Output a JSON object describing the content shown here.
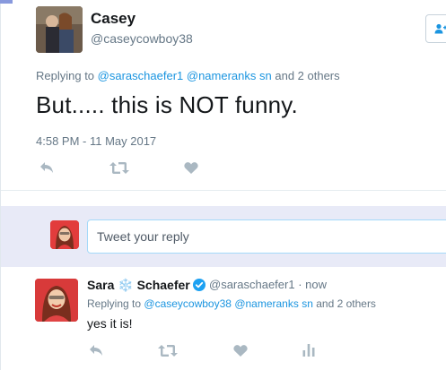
{
  "main_tweet": {
    "display_name": "Casey",
    "handle": "@caseycowboy38",
    "replying_prefix": "Replying to",
    "mention_1": "@saraschaefer1",
    "mention_2": "@nameranks sn",
    "others": "and 2 others",
    "text": "But..... this is NOT funny.",
    "timestamp": "4:58 PM - 11 May 2017"
  },
  "reply_box": {
    "placeholder": "Tweet your reply"
  },
  "reply_tweet": {
    "display_name_first": "Sara",
    "snowflake": "❄️",
    "display_name_last": "Schaefer",
    "handle": "@saraschaefer1",
    "separator": "·",
    "time": "now",
    "replying_prefix": "Replying to",
    "mention_1": "@caseycowboy38",
    "mention_2": "@nameranks sn",
    "others": "and 2 others",
    "text": "yes it is!"
  },
  "icons": {
    "reply": "reply-icon",
    "retweet": "retweet-icon",
    "like": "heart-icon",
    "analytics": "analytics-icon",
    "follow": "follow-user-icon",
    "verified": "verified-badge-icon"
  },
  "colors": {
    "link": "#1b95e0",
    "secondary_text": "#657786",
    "reply_band": "#e8eaf7",
    "action_icon": "#aab8c2",
    "verified": "#1da1f2"
  }
}
